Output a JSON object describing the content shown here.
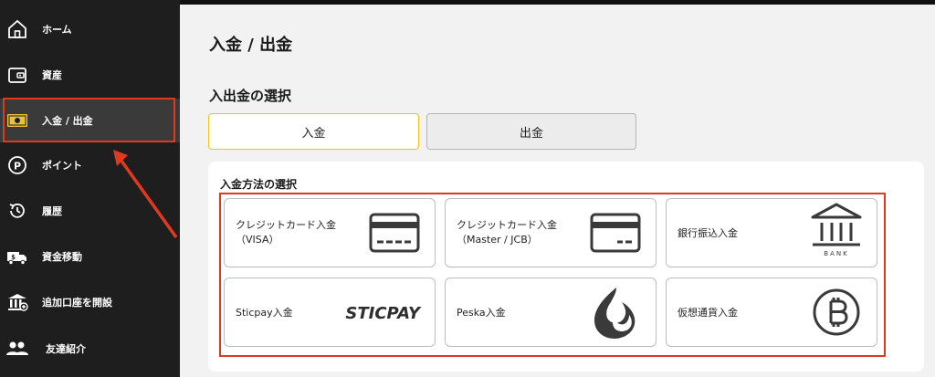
{
  "sidebar": {
    "items": [
      {
        "id": "home",
        "label": "ホーム",
        "icon": "home-icon"
      },
      {
        "id": "assets",
        "label": "資産",
        "icon": "wallet-icon"
      },
      {
        "id": "deposit-withdraw",
        "label": "入金 / 出金",
        "icon": "cash-icon",
        "active": true
      },
      {
        "id": "points",
        "label": "ポイント",
        "icon": "points-icon"
      },
      {
        "id": "history",
        "label": "履歴",
        "icon": "history-icon"
      },
      {
        "id": "fund-transfer",
        "label": "資金移動",
        "icon": "truck-icon"
      },
      {
        "id": "open-account",
        "label": "追加口座を開設",
        "icon": "bank-icon"
      },
      {
        "id": "referral",
        "label": "友達紹介",
        "icon": "users-icon"
      }
    ]
  },
  "main": {
    "title": "入金 / 出金",
    "selection_title": "入出金の選択",
    "tabs": [
      {
        "label": "入金",
        "selected": true
      },
      {
        "label": "出金",
        "selected": false
      }
    ],
    "methods": {
      "title": "入金方法の選択",
      "items": [
        {
          "line1": "クレジットカード入金",
          "line2": "（VISA）",
          "icon": "credit-card-icon"
        },
        {
          "line1": "クレジットカード入金",
          "line2": "（Master / JCB）",
          "icon": "credit-card-icon"
        },
        {
          "line1": "銀行振込入金",
          "line2": "",
          "icon": "bank-icon",
          "icon_text": "BANK"
        },
        {
          "line1": "Sticpay入金",
          "line2": "",
          "icon": "sticpay-logo",
          "icon_text": "STICPAY"
        },
        {
          "line1": "Peska入金",
          "line2": "",
          "icon": "peska-logo"
        },
        {
          "line1": "仮想通貨入金",
          "line2": "",
          "icon": "bitcoin-icon"
        }
      ]
    }
  },
  "colors": {
    "sidebar_bg": "#1e1e1e",
    "highlight_red": "#e03a1e",
    "tab_active_border": "#f0c419",
    "icon_dark": "#3a3a3a",
    "cash_icon": "#e8c33a"
  }
}
